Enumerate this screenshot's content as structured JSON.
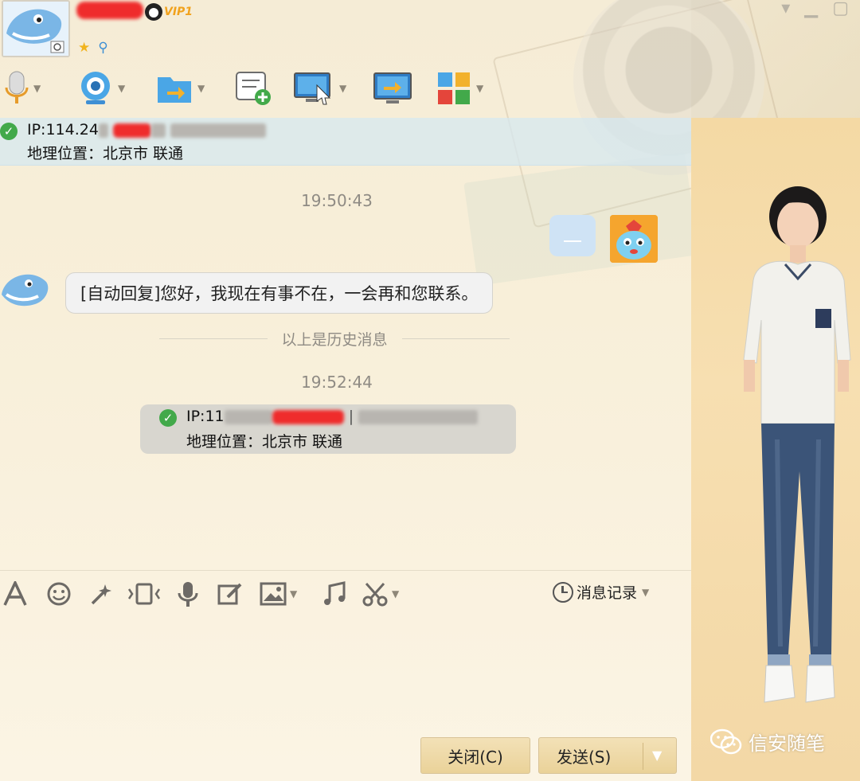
{
  "header": {
    "vip_label": "VIP1"
  },
  "info_bar": {
    "ip_prefix": "IP:114.24",
    "location_label": "地理位置：北京市 联通"
  },
  "chat": {
    "timestamp_1": "19:50:43",
    "auto_reply": "[自动回复]您好，我现在有事不在，一会再和您联系。",
    "history_divider": "以上是历史消息",
    "timestamp_2": "19:52:44",
    "system_ip_prefix": "IP:11",
    "system_location": "地理位置：北京市 联通"
  },
  "input_toolbar": {
    "history_label": "消息记录"
  },
  "buttons": {
    "close_label": "关闭(C)",
    "send_label": "发送(S)"
  },
  "watermark": {
    "text": "信安随笔"
  },
  "colors": {
    "accent_check": "#42a94a",
    "redaction": "#ef2c2c",
    "button_bg": "#ead299",
    "side_panel": "#f4d9a4"
  },
  "icons": {
    "toolbar": [
      "microphone-icon",
      "video-camera-icon",
      "file-transfer-icon",
      "new-document-icon",
      "screen-share-icon",
      "remote-assist-icon",
      "apps-grid-icon"
    ],
    "input": [
      "font-icon",
      "emoji-icon",
      "magic-icon",
      "vibrate-icon",
      "voice-message-icon",
      "edit-icon",
      "image-icon",
      "music-icon",
      "scissors-icon",
      "clock-icon"
    ]
  }
}
